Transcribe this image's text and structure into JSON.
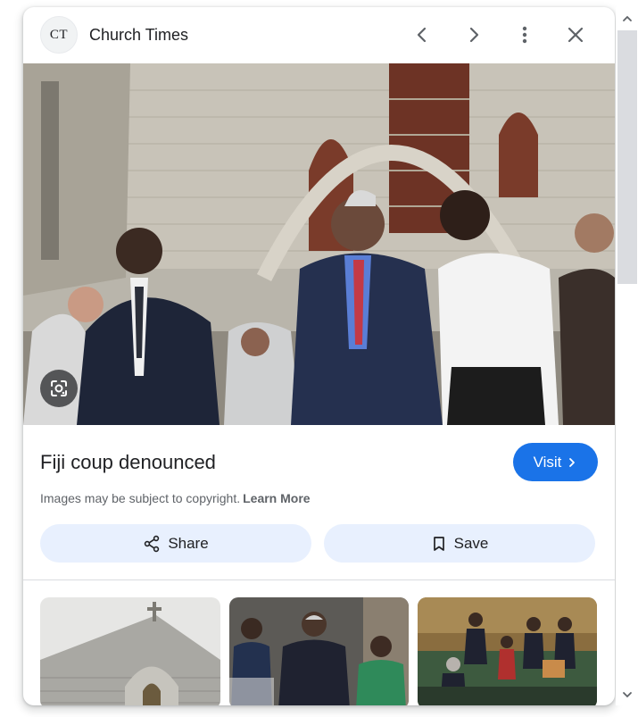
{
  "header": {
    "logo_text": "CT",
    "site_name": "Church Times",
    "icons": [
      "chevron-left-icon",
      "chevron-right-icon",
      "more-vert-icon",
      "close-icon"
    ]
  },
  "main": {
    "image_alt": "Men in suits walking down steps outside a stone church",
    "lens_icon": "google-lens-icon",
    "title": "Fiji coup denounced",
    "visit_label": "Visit",
    "copyright_text": "Images may be subject to copyright.",
    "learn_more": "Learn More",
    "share_label": "Share",
    "save_label": "Save"
  },
  "related": {
    "thumbnails": [
      {
        "alt": "Stone church with cross on gable"
      },
      {
        "alt": "Men in suits greeting crowd"
      },
      {
        "alt": "Parliament chamber with members standing"
      }
    ]
  },
  "colors": {
    "accent": "#1a73e8",
    "button_bg": "#e8f0fe",
    "text": "#202124",
    "muted": "#5f6368"
  }
}
